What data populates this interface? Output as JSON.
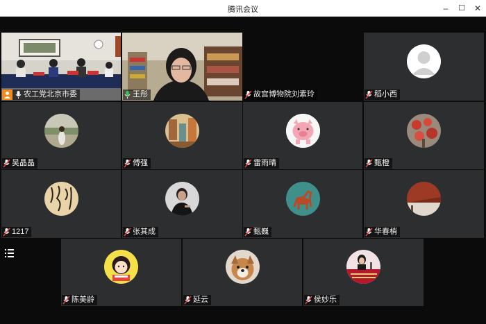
{
  "window": {
    "title": "腾讯会议"
  },
  "controls": {
    "minimize": "–",
    "maximize": "☐",
    "close": "✕"
  },
  "participants": [
    {
      "name": "农工党北京市委",
      "video": "conference-room",
      "host": true
    },
    {
      "name": "王彤",
      "video": "speaker-video",
      "active": true
    },
    {
      "name": "故宫博物院刘素玲",
      "video": "off"
    },
    {
      "name": "稻小西",
      "video": "default-avatar"
    },
    {
      "name": "吴晶晶",
      "avatar": "garden-photo-avatar"
    },
    {
      "name": "傅强",
      "avatar": "painting-avatar"
    },
    {
      "name": "雷雨晴",
      "avatar": "pink-pig-avatar"
    },
    {
      "name": "甄橙",
      "avatar": "red-flowers-avatar"
    },
    {
      "name": "1217",
      "avatar": "calligraphy-avatar"
    },
    {
      "name": "张其成",
      "avatar": "man-portrait-avatar"
    },
    {
      "name": "甄巍",
      "avatar": "horse-painting-avatar"
    },
    {
      "name": "华春梢",
      "avatar": "red-wall-avatar"
    },
    {
      "name": "陈美龄",
      "avatar": "cartoon-girl-avatar"
    },
    {
      "name": "延云",
      "avatar": "puppy-avatar"
    },
    {
      "name": "侯妙乐",
      "avatar": "lecturer-avatar"
    }
  ],
  "colors": {
    "tile": "#2d2e30",
    "accent_active": "#35c75a",
    "host_badge": "#f08a1c",
    "mic_muted": "#e04848"
  }
}
